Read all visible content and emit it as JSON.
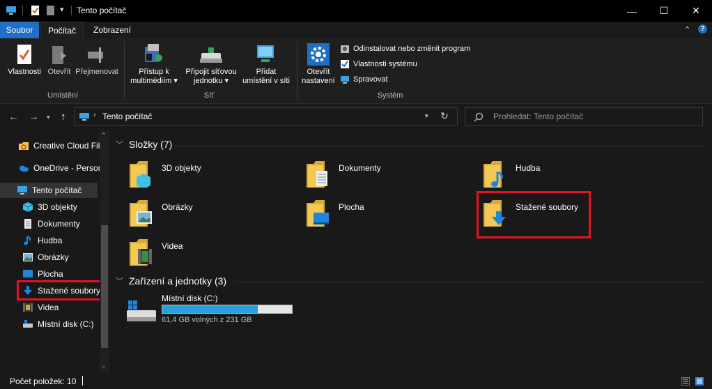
{
  "window": {
    "title": "Tento počítač",
    "minimize_glyph": "—",
    "maximize_glyph": "☐",
    "close_glyph": "✕"
  },
  "ribbon_tabs": [
    {
      "label": "Soubor",
      "active_color": "#1f6fc5"
    },
    {
      "label": "Počítač"
    },
    {
      "label": "Zobrazení"
    }
  ],
  "ribbon": {
    "umisteni": {
      "group_label": "Umístění",
      "vlastnosti": "Vlastnosti",
      "otevrit": "Otevřít",
      "prejmenovat": "Přejmenovat"
    },
    "sit": {
      "group_label": "Síť",
      "multimedia_line1": "Přístup k",
      "multimedia_line2": "multimédiím",
      "pripojit_line1": "Připojit síťovou",
      "pripojit_line2": "jednotku",
      "pridat_line1": "Přidat",
      "pridat_line2": "umístění v síti"
    },
    "system": {
      "group_label": "Systém",
      "otevrit_nastaveni_line1": "Otevřít",
      "otevrit_nastaveni_line2": "nastavení",
      "odinstalovat": "Odinstalovat nebo změnit program",
      "vlastnosti_systemu": "Vlastnosti systému",
      "spravovat": "Spravovat"
    }
  },
  "address": {
    "path": "Tento počítač",
    "search_placeholder": "Prohledat: Tento počítač"
  },
  "nav": {
    "creative_cloud": "Creative Cloud Fil",
    "onedrive": "OneDrive - Persor",
    "tento_pocitac": "Tento počítač",
    "objekty3d": "3D objekty",
    "dokumenty": "Dokumenty",
    "hudba": "Hudba",
    "obrazky": "Obrázky",
    "plocha": "Plocha",
    "stazene": "Stažené soubory",
    "videa": "Videa",
    "mistni_disk": "Místní disk (C:)"
  },
  "content": {
    "folders_header": "Složky (7)",
    "folders": {
      "objekty3d": "3D objekty",
      "dokumenty": "Dokumenty",
      "hudba": "Hudba",
      "obrazky": "Obrázky",
      "plocha": "Plocha",
      "stazene": "Stažené soubory",
      "videa": "Videa"
    },
    "devices_header": "Zařízení a jednotky (3)",
    "drive": {
      "name": "Místní disk (C:)",
      "free_text": "61,4 GB volných z 231 GB",
      "used_fraction": 0.734
    }
  },
  "status": {
    "item_count": "Počet položek: 10"
  },
  "colors": {
    "accent": "#1f6fc5",
    "highlight_red": "#e81123",
    "folder_yellow": "#f3c955",
    "drive_bar": "#26a0da"
  }
}
